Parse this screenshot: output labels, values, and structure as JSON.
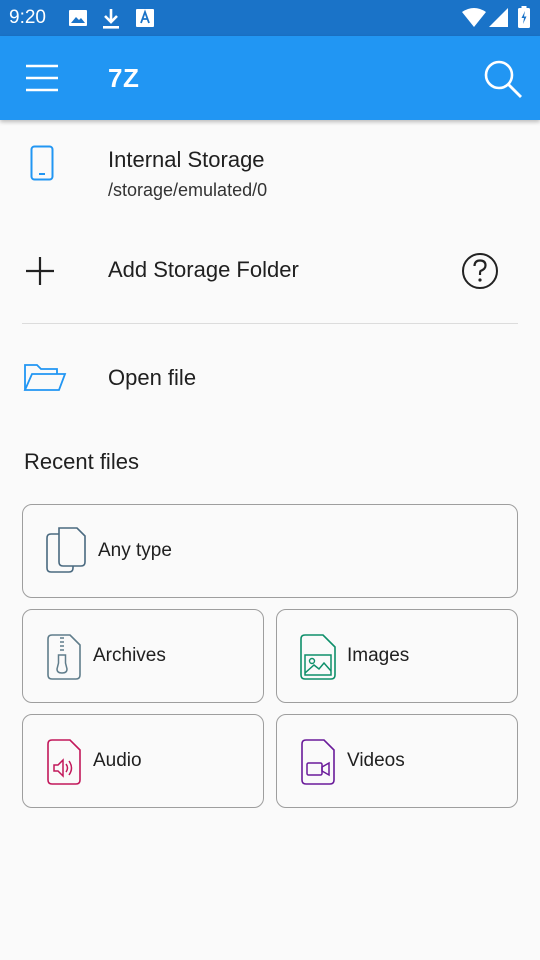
{
  "status_bar": {
    "time": "9:20",
    "icons": [
      "image-icon",
      "download-icon",
      "font-icon",
      "wifi-icon",
      "signal-icon",
      "battery-icon"
    ]
  },
  "app_bar": {
    "title": "7Z",
    "menu_icon": "menu-icon",
    "search_icon": "search-icon",
    "color": "#2196f3"
  },
  "storage": {
    "internal": {
      "title": "Internal Storage",
      "path": "/storage/emulated/0",
      "icon": "phone-icon"
    },
    "add_folder": {
      "label": "Add Storage Folder",
      "icon": "plus-icon",
      "help_icon": "help-icon"
    },
    "open_file": {
      "label": "Open file",
      "icon": "folder-open-icon"
    }
  },
  "recent": {
    "title": "Recent files",
    "items": [
      {
        "label": "Any type",
        "icon": "files-icon",
        "color": "#4a6a80"
      },
      {
        "label": "Archives",
        "icon": "archive-icon",
        "color": "#607d8b"
      },
      {
        "label": "Images",
        "icon": "image-file-icon",
        "color": "#0e8f6a"
      },
      {
        "label": "Audio",
        "icon": "audio-file-icon",
        "color": "#c2185b"
      },
      {
        "label": "Videos",
        "icon": "video-file-icon",
        "color": "#6a1b9a"
      }
    ]
  }
}
